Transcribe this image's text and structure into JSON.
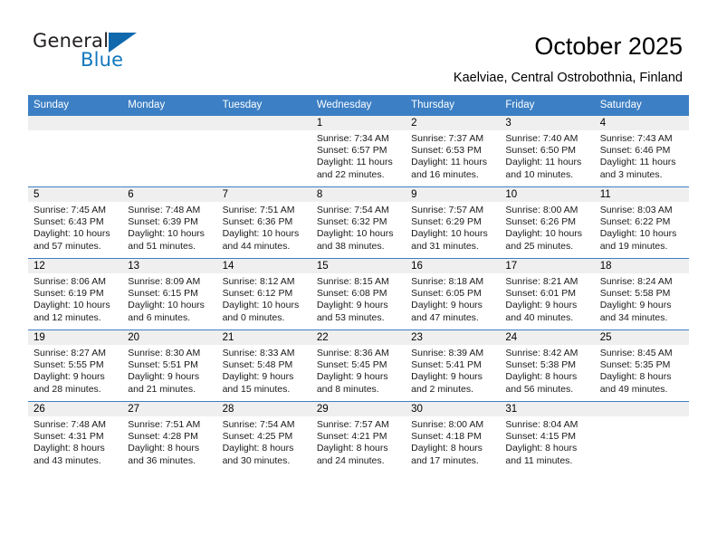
{
  "brand": {
    "name_part1": "General",
    "name_part2": "Blue",
    "accent_color": "#1169ad",
    "logo_text_color": "#231f20"
  },
  "header": {
    "title": "October 2025",
    "subtitle": "Kaelviae, Central Ostrobothnia, Finland"
  },
  "calendar": {
    "header_bg": "#3c7fc4",
    "daynum_bg": "#efefef",
    "weekday_headers": [
      "Sunday",
      "Monday",
      "Tuesday",
      "Wednesday",
      "Thursday",
      "Friday",
      "Saturday"
    ],
    "labels": {
      "sunrise": "Sunrise:",
      "sunset": "Sunset:",
      "daylight": "Daylight:"
    },
    "weeks": [
      [
        {
          "day": "",
          "sunrise": "",
          "sunset": "",
          "daylight_line1": "",
          "daylight_line2": ""
        },
        {
          "day": "",
          "sunrise": "",
          "sunset": "",
          "daylight_line1": "",
          "daylight_line2": ""
        },
        {
          "day": "",
          "sunrise": "",
          "sunset": "",
          "daylight_line1": "",
          "daylight_line2": ""
        },
        {
          "day": "1",
          "sunrise": "Sunrise: 7:34 AM",
          "sunset": "Sunset: 6:57 PM",
          "daylight_line1": "Daylight: 11 hours",
          "daylight_line2": "and 22 minutes."
        },
        {
          "day": "2",
          "sunrise": "Sunrise: 7:37 AM",
          "sunset": "Sunset: 6:53 PM",
          "daylight_line1": "Daylight: 11 hours",
          "daylight_line2": "and 16 minutes."
        },
        {
          "day": "3",
          "sunrise": "Sunrise: 7:40 AM",
          "sunset": "Sunset: 6:50 PM",
          "daylight_line1": "Daylight: 11 hours",
          "daylight_line2": "and 10 minutes."
        },
        {
          "day": "4",
          "sunrise": "Sunrise: 7:43 AM",
          "sunset": "Sunset: 6:46 PM",
          "daylight_line1": "Daylight: 11 hours",
          "daylight_line2": "and 3 minutes."
        }
      ],
      [
        {
          "day": "5",
          "sunrise": "Sunrise: 7:45 AM",
          "sunset": "Sunset: 6:43 PM",
          "daylight_line1": "Daylight: 10 hours",
          "daylight_line2": "and 57 minutes."
        },
        {
          "day": "6",
          "sunrise": "Sunrise: 7:48 AM",
          "sunset": "Sunset: 6:39 PM",
          "daylight_line1": "Daylight: 10 hours",
          "daylight_line2": "and 51 minutes."
        },
        {
          "day": "7",
          "sunrise": "Sunrise: 7:51 AM",
          "sunset": "Sunset: 6:36 PM",
          "daylight_line1": "Daylight: 10 hours",
          "daylight_line2": "and 44 minutes."
        },
        {
          "day": "8",
          "sunrise": "Sunrise: 7:54 AM",
          "sunset": "Sunset: 6:32 PM",
          "daylight_line1": "Daylight: 10 hours",
          "daylight_line2": "and 38 minutes."
        },
        {
          "day": "9",
          "sunrise": "Sunrise: 7:57 AM",
          "sunset": "Sunset: 6:29 PM",
          "daylight_line1": "Daylight: 10 hours",
          "daylight_line2": "and 31 minutes."
        },
        {
          "day": "10",
          "sunrise": "Sunrise: 8:00 AM",
          "sunset": "Sunset: 6:26 PM",
          "daylight_line1": "Daylight: 10 hours",
          "daylight_line2": "and 25 minutes."
        },
        {
          "day": "11",
          "sunrise": "Sunrise: 8:03 AM",
          "sunset": "Sunset: 6:22 PM",
          "daylight_line1": "Daylight: 10 hours",
          "daylight_line2": "and 19 minutes."
        }
      ],
      [
        {
          "day": "12",
          "sunrise": "Sunrise: 8:06 AM",
          "sunset": "Sunset: 6:19 PM",
          "daylight_line1": "Daylight: 10 hours",
          "daylight_line2": "and 12 minutes."
        },
        {
          "day": "13",
          "sunrise": "Sunrise: 8:09 AM",
          "sunset": "Sunset: 6:15 PM",
          "daylight_line1": "Daylight: 10 hours",
          "daylight_line2": "and 6 minutes."
        },
        {
          "day": "14",
          "sunrise": "Sunrise: 8:12 AM",
          "sunset": "Sunset: 6:12 PM",
          "daylight_line1": "Daylight: 10 hours",
          "daylight_line2": "and 0 minutes."
        },
        {
          "day": "15",
          "sunrise": "Sunrise: 8:15 AM",
          "sunset": "Sunset: 6:08 PM",
          "daylight_line1": "Daylight: 9 hours",
          "daylight_line2": "and 53 minutes."
        },
        {
          "day": "16",
          "sunrise": "Sunrise: 8:18 AM",
          "sunset": "Sunset: 6:05 PM",
          "daylight_line1": "Daylight: 9 hours",
          "daylight_line2": "and 47 minutes."
        },
        {
          "day": "17",
          "sunrise": "Sunrise: 8:21 AM",
          "sunset": "Sunset: 6:01 PM",
          "daylight_line1": "Daylight: 9 hours",
          "daylight_line2": "and 40 minutes."
        },
        {
          "day": "18",
          "sunrise": "Sunrise: 8:24 AM",
          "sunset": "Sunset: 5:58 PM",
          "daylight_line1": "Daylight: 9 hours",
          "daylight_line2": "and 34 minutes."
        }
      ],
      [
        {
          "day": "19",
          "sunrise": "Sunrise: 8:27 AM",
          "sunset": "Sunset: 5:55 PM",
          "daylight_line1": "Daylight: 9 hours",
          "daylight_line2": "and 28 minutes."
        },
        {
          "day": "20",
          "sunrise": "Sunrise: 8:30 AM",
          "sunset": "Sunset: 5:51 PM",
          "daylight_line1": "Daylight: 9 hours",
          "daylight_line2": "and 21 minutes."
        },
        {
          "day": "21",
          "sunrise": "Sunrise: 8:33 AM",
          "sunset": "Sunset: 5:48 PM",
          "daylight_line1": "Daylight: 9 hours",
          "daylight_line2": "and 15 minutes."
        },
        {
          "day": "22",
          "sunrise": "Sunrise: 8:36 AM",
          "sunset": "Sunset: 5:45 PM",
          "daylight_line1": "Daylight: 9 hours",
          "daylight_line2": "and 8 minutes."
        },
        {
          "day": "23",
          "sunrise": "Sunrise: 8:39 AM",
          "sunset": "Sunset: 5:41 PM",
          "daylight_line1": "Daylight: 9 hours",
          "daylight_line2": "and 2 minutes."
        },
        {
          "day": "24",
          "sunrise": "Sunrise: 8:42 AM",
          "sunset": "Sunset: 5:38 PM",
          "daylight_line1": "Daylight: 8 hours",
          "daylight_line2": "and 56 minutes."
        },
        {
          "day": "25",
          "sunrise": "Sunrise: 8:45 AM",
          "sunset": "Sunset: 5:35 PM",
          "daylight_line1": "Daylight: 8 hours",
          "daylight_line2": "and 49 minutes."
        }
      ],
      [
        {
          "day": "26",
          "sunrise": "Sunrise: 7:48 AM",
          "sunset": "Sunset: 4:31 PM",
          "daylight_line1": "Daylight: 8 hours",
          "daylight_line2": "and 43 minutes."
        },
        {
          "day": "27",
          "sunrise": "Sunrise: 7:51 AM",
          "sunset": "Sunset: 4:28 PM",
          "daylight_line1": "Daylight: 8 hours",
          "daylight_line2": "and 36 minutes."
        },
        {
          "day": "28",
          "sunrise": "Sunrise: 7:54 AM",
          "sunset": "Sunset: 4:25 PM",
          "daylight_line1": "Daylight: 8 hours",
          "daylight_line2": "and 30 minutes."
        },
        {
          "day": "29",
          "sunrise": "Sunrise: 7:57 AM",
          "sunset": "Sunset: 4:21 PM",
          "daylight_line1": "Daylight: 8 hours",
          "daylight_line2": "and 24 minutes."
        },
        {
          "day": "30",
          "sunrise": "Sunrise: 8:00 AM",
          "sunset": "Sunset: 4:18 PM",
          "daylight_line1": "Daylight: 8 hours",
          "daylight_line2": "and 17 minutes."
        },
        {
          "day": "31",
          "sunrise": "Sunrise: 8:04 AM",
          "sunset": "Sunset: 4:15 PM",
          "daylight_line1": "Daylight: 8 hours",
          "daylight_line2": "and 11 minutes."
        },
        {
          "day": "",
          "sunrise": "",
          "sunset": "",
          "daylight_line1": "",
          "daylight_line2": ""
        }
      ]
    ]
  }
}
